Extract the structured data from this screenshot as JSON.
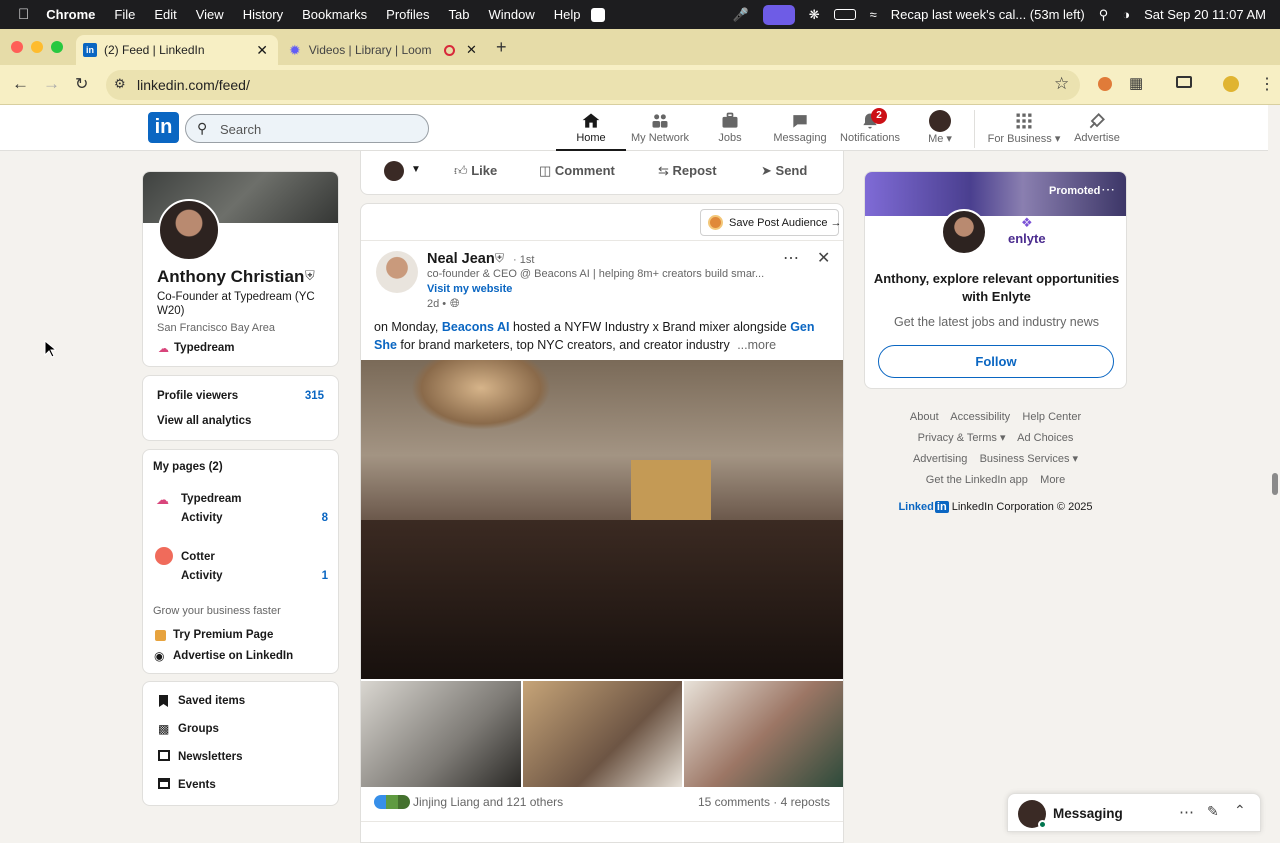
{
  "menubar": {
    "app": "Chrome",
    "items": [
      "File",
      "Edit",
      "View",
      "History",
      "Bookmarks",
      "Profiles",
      "Tab",
      "Window",
      "Help"
    ],
    "status_text": "Recap last week's cal... (53m left)",
    "datetime": "Sat Sep 20  11:07 AM"
  },
  "tabs": [
    {
      "title": "(2) Feed | LinkedIn"
    },
    {
      "title": "Videos | Library | Loom"
    }
  ],
  "address": {
    "url": "linkedin.com/feed/"
  },
  "header": {
    "search_placeholder": "Search",
    "nav": [
      {
        "label": "Home"
      },
      {
        "label": "My Network"
      },
      {
        "label": "Jobs"
      },
      {
        "label": "Messaging"
      },
      {
        "label": "Notifications",
        "badge": "2"
      },
      {
        "label": "Me"
      },
      {
        "label": "For Business"
      },
      {
        "label": "Advertise"
      }
    ]
  },
  "profile": {
    "name": "Anthony Christian",
    "headline_line1": "Co-Founder at Typedream (YC",
    "headline_line2": "W20)",
    "location": "San Francisco Bay Area",
    "company": "Typedream",
    "viewers_label": "Profile viewers",
    "viewers_count": "315",
    "analytics_link": "View all analytics"
  },
  "pages": {
    "title": "My pages (2)",
    "items": [
      {
        "name": "Typedream",
        "activity_label": "Activity",
        "activity_count": "8"
      },
      {
        "name": "Cotter",
        "activity_label": "Activity",
        "activity_count": "1"
      }
    ],
    "grow_text": "Grow your business faster",
    "premium_link": "Try Premium Page",
    "advertise_link": "Advertise on LinkedIn"
  },
  "shortcuts": [
    "Saved items",
    "Groups",
    "Newsletters",
    "Events"
  ],
  "action_bar": {
    "like": "Like",
    "comment": "Comment",
    "repost": "Repost",
    "send": "Send"
  },
  "save_audience": "Save Post Audience →",
  "post": {
    "author": "Neal Jean",
    "degree": "· 1st",
    "subtitle": "co-founder & CEO @ Beacons AI | helping 8m+ creators build smar...",
    "website": "Visit my website",
    "time": "2d •",
    "text_a": "on Monday, ",
    "link_a": "Beacons AI",
    "text_b": " hosted a NYFW Industry x Brand mixer alongside ",
    "link_b": "Gen",
    "link_c": "She",
    "text_c": " for brand marketers, top NYC creators, and creator industry",
    "more": "...more",
    "reactions": "Jinjing Liang and 121 others",
    "stats": "15 comments · 4 reposts"
  },
  "ad": {
    "promoted": "Promoted",
    "brand": "enlyte",
    "headline_line1": "Anthony, explore relevant opportunities",
    "headline_line2": "with Enlyte",
    "subtext": "Get the latest jobs and industry news",
    "follow": "Follow"
  },
  "footer": {
    "row1": [
      "About",
      "Accessibility",
      "Help Center"
    ],
    "row2": [
      "Privacy & Terms",
      "Ad Choices"
    ],
    "row3": [
      "Advertising",
      "Business Services"
    ],
    "row4": [
      "Get the LinkedIn app",
      "More"
    ],
    "brand": "Linked",
    "copyright": "LinkedIn Corporation © 2025"
  },
  "messaging": {
    "label": "Messaging"
  },
  "colors": {
    "accent": "#0a66c2",
    "badge": "#cc1016",
    "menubar": "#1d1d1f",
    "tabstrip": "#e6dca8"
  }
}
